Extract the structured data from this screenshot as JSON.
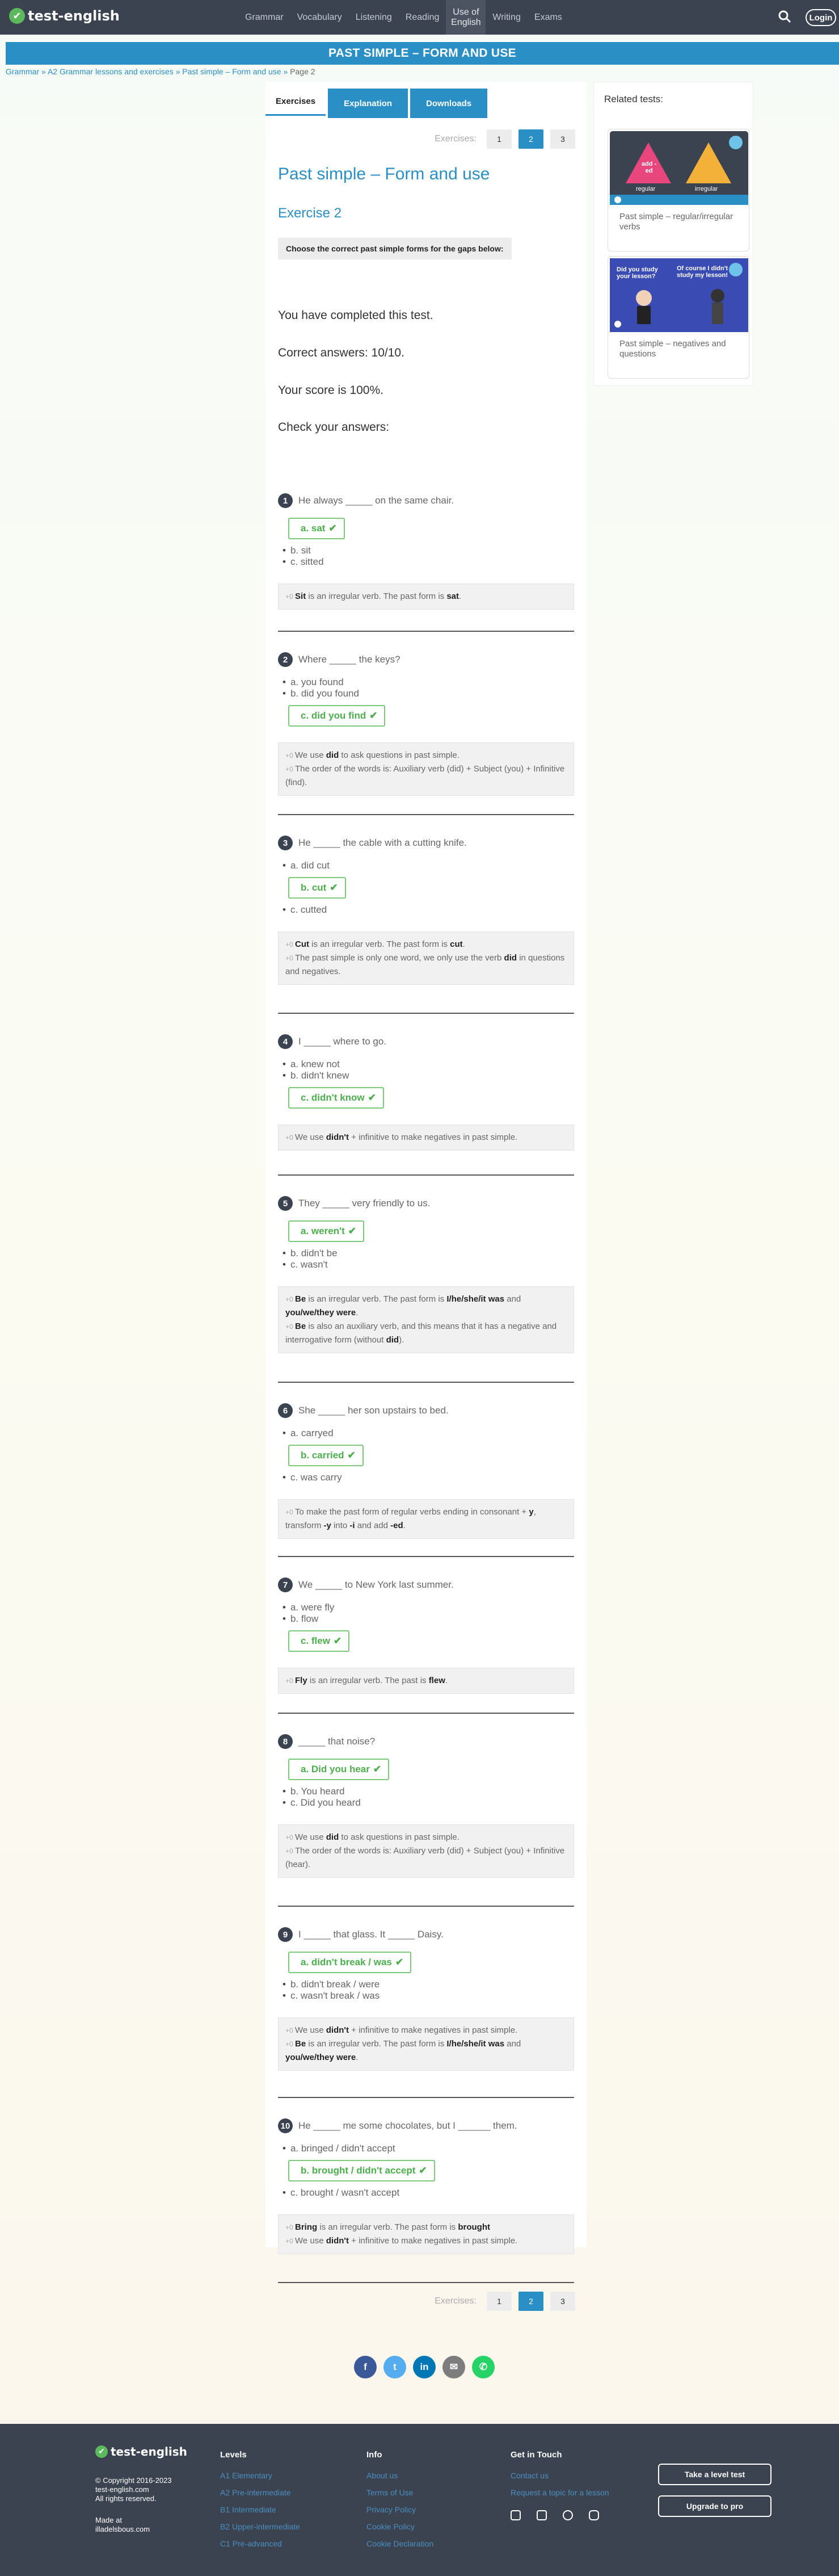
{
  "brand": {
    "name": "test-english",
    "logo_mark": "✔"
  },
  "nav": {
    "items": [
      "Grammar",
      "Vocabulary",
      "Listening",
      "Reading",
      "Use of English",
      "Writing",
      "Exams"
    ],
    "login": "Login"
  },
  "banner": {
    "title": "PAST SIMPLE – FORM AND USE"
  },
  "breadcrumb": {
    "items": [
      "Grammar",
      "A2 Grammar lessons and exercises",
      "Past simple – Form and use"
    ],
    "current": "Page 2",
    "separator": "»"
  },
  "tabs": {
    "exercises": "Exercises",
    "explanation": "Explanation",
    "downloads": "Downloads"
  },
  "pager": {
    "label": "Exercises:",
    "pages": [
      "1",
      "2",
      "3"
    ],
    "current": "2"
  },
  "lesson": {
    "title": "Past simple – Form and use",
    "exercise": "Exercise 2",
    "instruction": "Choose the correct past simple forms for the gaps below:"
  },
  "result": {
    "completed": "You have completed this test.",
    "correct": "Correct answers: 10/10.",
    "score": "Your score is 100%.",
    "check": "Check your answers:"
  },
  "questions": [
    {
      "n": "1",
      "text": "He always _____ on the same chair.",
      "options": [
        {
          "t": "a. sat",
          "ok": true
        },
        {
          "t": "b. sit",
          "ok": false
        },
        {
          "t": "c. sitted",
          "ok": false
        }
      ],
      "expl": [
        [
          {
            "t": "Sit",
            "b": true
          },
          {
            "t": " is an irregular verb. The past form is "
          },
          {
            "t": "sat",
            "b": true
          },
          {
            "t": "."
          }
        ]
      ]
    },
    {
      "n": "2",
      "text": "Where _____ the keys?",
      "options": [
        {
          "t": "a. you found",
          "ok": false
        },
        {
          "t": "b. did you found",
          "ok": false
        },
        {
          "t": "c. did you find",
          "ok": true
        }
      ],
      "expl": [
        [
          {
            "t": "We use "
          },
          {
            "t": "did",
            "b": true
          },
          {
            "t": " to ask questions in past simple."
          }
        ],
        [
          {
            "t": "The order of the words is: Auxiliary verb (did) + Subject (you) + Infinitive (find)."
          }
        ]
      ]
    },
    {
      "n": "3",
      "text": "He _____ the cable with a cutting knife.",
      "options": [
        {
          "t": "a. did cut",
          "ok": false
        },
        {
          "t": "b. cut",
          "ok": true
        },
        {
          "t": "c. cutted",
          "ok": false
        }
      ],
      "expl": [
        [
          {
            "t": "Cut",
            "b": true
          },
          {
            "t": " is an irregular verb. The past form is "
          },
          {
            "t": "cut",
            "b": true
          },
          {
            "t": "."
          }
        ],
        [
          {
            "t": "The past simple is only one word, we only use the verb "
          },
          {
            "t": "did",
            "b": true
          },
          {
            "t": " in questions and negatives."
          }
        ]
      ]
    },
    {
      "n": "4",
      "text": "I _____ where to go.",
      "options": [
        {
          "t": "a. knew not",
          "ok": false
        },
        {
          "t": "b. didn't knew",
          "ok": false
        },
        {
          "t": "c. didn't know",
          "ok": true
        }
      ],
      "expl": [
        [
          {
            "t": "We use "
          },
          {
            "t": "didn't",
            "b": true
          },
          {
            "t": " + infinitive to make negatives in past simple."
          }
        ]
      ]
    },
    {
      "n": "5",
      "text": "They _____ very friendly to us.",
      "options": [
        {
          "t": "a. weren't",
          "ok": true
        },
        {
          "t": "b. didn't be",
          "ok": false
        },
        {
          "t": "c. wasn't",
          "ok": false
        }
      ],
      "expl": [
        [
          {
            "t": "Be",
            "b": true
          },
          {
            "t": " is an irregular verb. The past form is "
          },
          {
            "t": "I/he/she/it was",
            "b": true
          },
          {
            "t": " and "
          },
          {
            "t": "you/we/they were",
            "b": true
          },
          {
            "t": "."
          }
        ],
        [
          {
            "t": "Be",
            "b": true
          },
          {
            "t": " is also an auxiliary verb, and this means that it has a negative and interrogative form (without "
          },
          {
            "t": "did",
            "b": true
          },
          {
            "t": ")."
          }
        ]
      ]
    },
    {
      "n": "6",
      "text": "She _____ her son upstairs to bed.",
      "options": [
        {
          "t": "a. carryed",
          "ok": false
        },
        {
          "t": "b. carried",
          "ok": true
        },
        {
          "t": "c. was carry",
          "ok": false
        }
      ],
      "expl": [
        [
          {
            "t": "To make the past form of regular verbs ending in consonant + "
          },
          {
            "t": "y",
            "b": true
          },
          {
            "t": ", transform "
          },
          {
            "t": "-y",
            "b": true
          },
          {
            "t": " into "
          },
          {
            "t": "-i",
            "b": true
          },
          {
            "t": " and add "
          },
          {
            "t": "-ed",
            "b": true
          },
          {
            "t": "."
          }
        ]
      ]
    },
    {
      "n": "7",
      "text": "We _____ to New York last summer.",
      "options": [
        {
          "t": "a. were fly",
          "ok": false
        },
        {
          "t": "b. flow",
          "ok": false
        },
        {
          "t": "c. flew",
          "ok": true
        }
      ],
      "expl": [
        [
          {
            "t": "Fly",
            "b": true
          },
          {
            "t": " is an irregular verb. The past is "
          },
          {
            "t": "flew",
            "b": true
          },
          {
            "t": "."
          }
        ]
      ]
    },
    {
      "n": "8",
      "text": "_____ that noise?",
      "options": [
        {
          "t": "a. Did you hear",
          "ok": true
        },
        {
          "t": "b. You heard",
          "ok": false
        },
        {
          "t": "c. Did you heard",
          "ok": false
        }
      ],
      "expl": [
        [
          {
            "t": "We use "
          },
          {
            "t": "did",
            "b": true
          },
          {
            "t": " to ask questions in past simple."
          }
        ],
        [
          {
            "t": "The order of the words is: Auxiliary verb (did) + Subject (you) + Infinitive (hear)."
          }
        ]
      ]
    },
    {
      "n": "9",
      "text": "I _____ that glass. It _____ Daisy.",
      "options": [
        {
          "t": "a. didn't break / was",
          "ok": true
        },
        {
          "t": "b. didn't break / were",
          "ok": false
        },
        {
          "t": "c. wasn't break / was",
          "ok": false
        }
      ],
      "expl": [
        [
          {
            "t": "We use "
          },
          {
            "t": "didn't",
            "b": true
          },
          {
            "t": " + infinitive to make negatives in past simple."
          }
        ],
        [
          {
            "t": "Be",
            "b": true
          },
          {
            "t": " is an irregular verb. The past form is "
          },
          {
            "t": "I/he/she/it was",
            "b": true
          },
          {
            "t": " and "
          },
          {
            "t": "you/we/they were",
            "b": true
          },
          {
            "t": "."
          }
        ]
      ]
    },
    {
      "n": "10",
      "text": "He _____ me some chocolates, but I ______ them.",
      "options": [
        {
          "t": "a. bringed / didn't accept",
          "ok": false
        },
        {
          "t": "b. brought / didn't accept",
          "ok": true
        },
        {
          "t": "c. brought / wasn't accept",
          "ok": false
        }
      ],
      "expl": [
        [
          {
            "t": "Bring",
            "b": true
          },
          {
            "t": " is an irregular verb. The past form is "
          },
          {
            "t": "brought",
            "b": true
          }
        ],
        [
          {
            "t": "We use "
          },
          {
            "t": "didn't",
            "b": true
          },
          {
            "t": " + infinitive to make negatives in past simple."
          }
        ]
      ]
    }
  ],
  "related": {
    "title": "Related tests:",
    "cards": [
      {
        "caption": "Past simple – regular/irregular verbs",
        "img_left": "add -ed",
        "img_left_sub": "regular",
        "img_right": "irregular"
      },
      {
        "caption": "Past simple – negatives and questions",
        "img_left": "Did you study your lesson?",
        "img_right": "Of course I didn't study my lesson!"
      }
    ]
  },
  "share": {
    "icons": [
      "facebook-icon",
      "twitter-icon",
      "linkedin-icon",
      "email-icon",
      "whatsapp-icon"
    ]
  },
  "footer": {
    "copyright": "© Copyright 2016-2023",
    "site": "test-english.com",
    "rights": "All rights reserved.",
    "made_at": "Made at",
    "made_by": "illadelsbous.com",
    "levels_title": "Levels",
    "levels": [
      "A1 Elementary",
      "A2 Pre-intermediate",
      "B1 Intermediate",
      "B2 Upper-intermediate",
      "C1 Pre-advanced"
    ],
    "info_title": "Info",
    "info": [
      "About us",
      "Terms of Use",
      "Privacy Policy",
      "Cookie Policy",
      "Cookie Declaration"
    ],
    "touch_title": "Get in Touch",
    "touch": [
      "Contact us",
      "Request a topic for a lesson"
    ],
    "btn_level": "Take a level test",
    "btn_pro": "Upgrade to pro"
  },
  "colors": {
    "brand_blue": "#2a8fc4",
    "topbar": "#3b4250",
    "correct_green": "#4cae4c"
  }
}
